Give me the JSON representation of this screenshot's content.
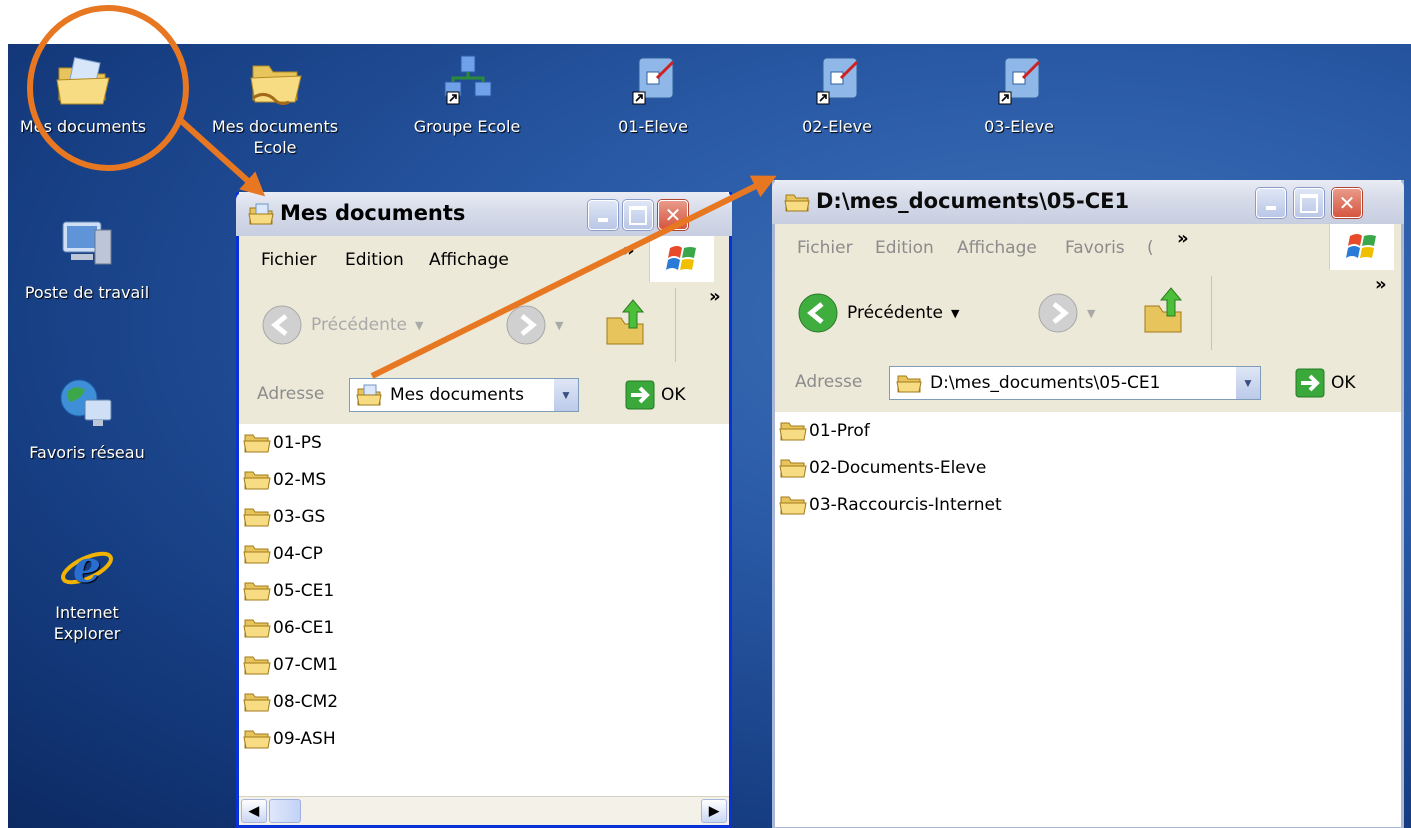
{
  "desktop": {
    "icons_top": [
      {
        "label": "Mes documents",
        "label2": ""
      },
      {
        "label": "Mes documents",
        "label2": "Ecole"
      },
      {
        "label": "Groupe Ecole",
        "label2": ""
      },
      {
        "label": "01-Eleve",
        "label2": ""
      },
      {
        "label": "02-Eleve",
        "label2": ""
      },
      {
        "label": "03-Eleve",
        "label2": ""
      }
    ],
    "icons_left": [
      {
        "label": "Poste de travail",
        "label2": ""
      },
      {
        "label": "Favoris réseau",
        "label2": ""
      },
      {
        "label": "Internet",
        "label2": "Explorer"
      }
    ]
  },
  "window_left": {
    "title": "Mes documents",
    "menu": [
      "Fichier",
      "Edition",
      "Affichage"
    ],
    "chevron": "»",
    "toolbar": {
      "back_label": "Précédente",
      "chevron": "»"
    },
    "address": {
      "label": "Adresse",
      "value": "Mes documents",
      "go_label": "OK"
    },
    "folders": [
      "01-PS",
      "02-MS",
      "03-GS",
      "04-CP",
      "05-CE1",
      "06-CE1",
      "07-CM1",
      "08-CM2",
      "09-ASH"
    ]
  },
  "window_right": {
    "title": "D:\\mes_documents\\05-CE1",
    "menu": [
      "Fichier",
      "Edition",
      "Affichage",
      "Favoris",
      "("
    ],
    "chevron": "»",
    "toolbar": {
      "back_label": "Précédente",
      "chevron": "»"
    },
    "address": {
      "label": "Adresse",
      "value": "D:\\mes_documents\\05-CE1",
      "go_label": "OK"
    },
    "folders": [
      "01-Prof",
      "02-Documents-Eleve",
      "03-Raccourcis-Internet"
    ]
  },
  "colors": {
    "annotation": "#e87722",
    "folder": "#f3d77a",
    "desktop": "#2a5aa6",
    "title_active": "#0831d9"
  },
  "icons": [
    "my-documents-icon",
    "shared-folder-icon",
    "network-group-icon",
    "shortcut-icon",
    "my-computer-icon",
    "network-places-icon",
    "internet-explorer-icon",
    "folder-icon",
    "back-arrow-icon",
    "forward-arrow-icon",
    "up-folder-icon",
    "go-arrow-icon",
    "windows-flag-icon"
  ]
}
